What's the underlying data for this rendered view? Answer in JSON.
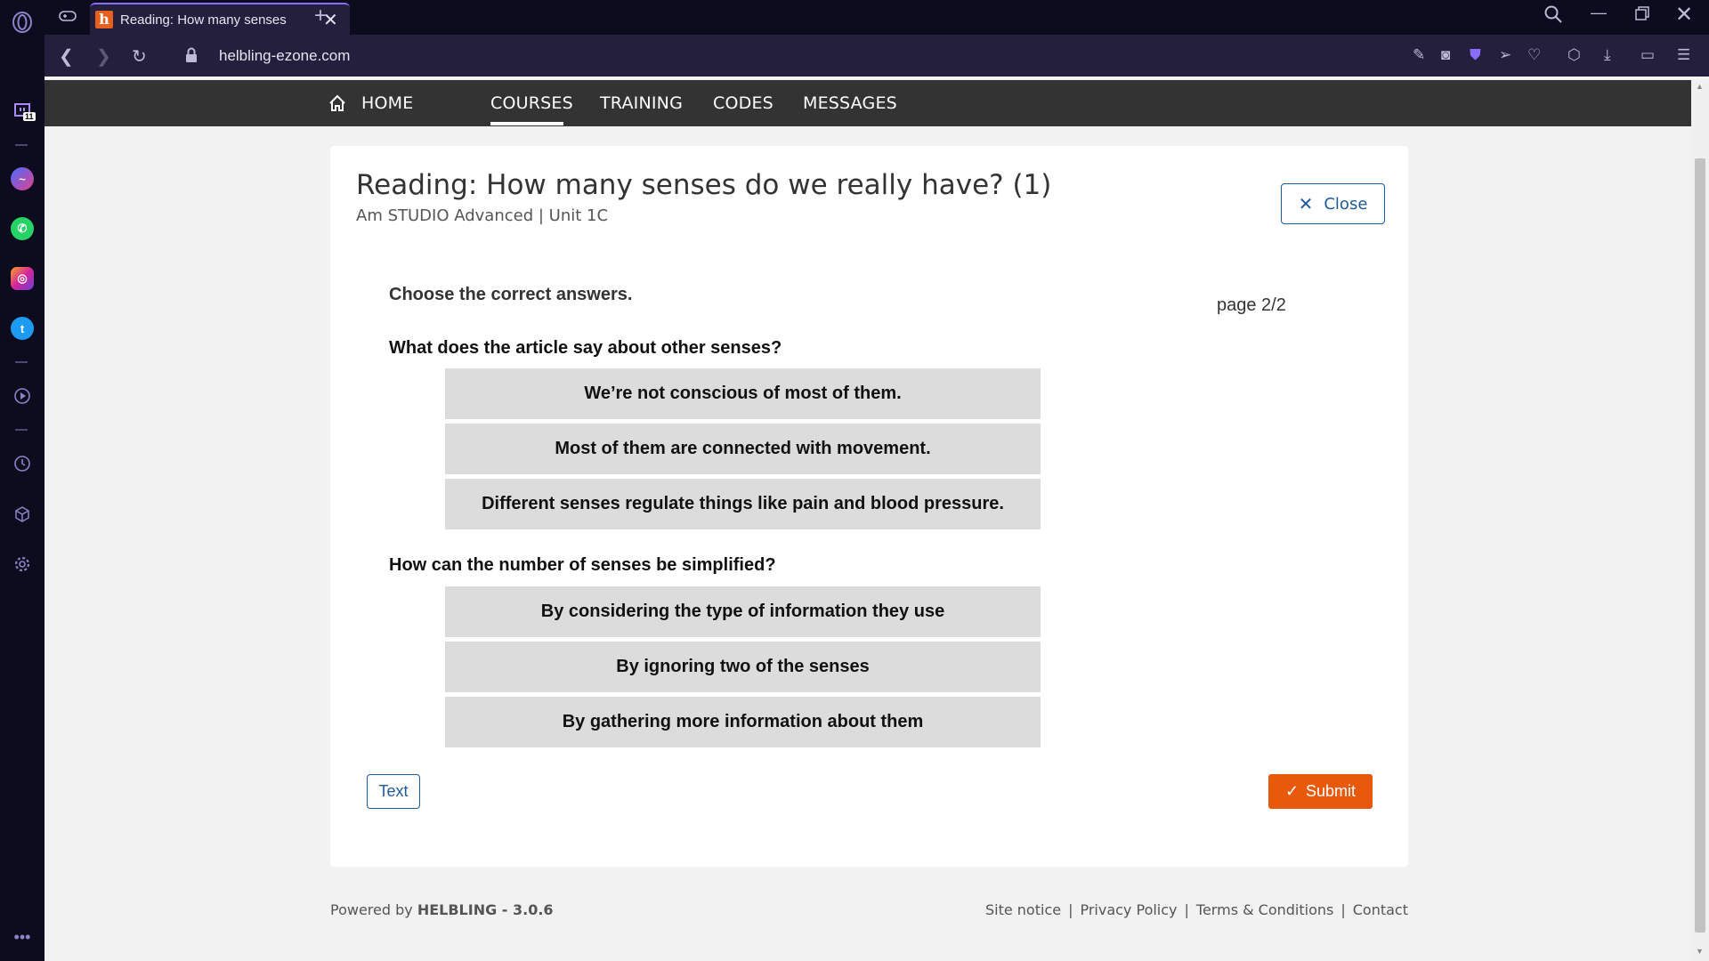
{
  "browser": {
    "tab_title": "Reading: How many senses",
    "favicon_letter": "h",
    "url": "helbling-ezone.com",
    "sidebar_badge": "11"
  },
  "site_nav": {
    "items": [
      "HOME",
      "COURSES",
      "TRAINING",
      "CODES",
      "MESSAGES"
    ],
    "active": "COURSES"
  },
  "activity": {
    "title": "Reading: How many senses do we really have? (1)",
    "subtitle": "Am STUDIO Advanced | Unit 1C",
    "close_label": "Close",
    "instruction": "Choose the correct answers.",
    "page_indicator": "page 2/2",
    "questions": [
      {
        "text": "What does the article say about other senses?",
        "options": [
          "We’re not conscious of most of them.",
          "Most of them are connected with movement.",
          "Different senses regulate things like pain and blood pressure."
        ]
      },
      {
        "text": "How can the number of senses be simplified?",
        "options": [
          "By considering the type of information they use",
          "By ignoring two of the senses",
          "By gathering more information about them"
        ]
      }
    ],
    "text_button": "Text",
    "submit_button": "Submit"
  },
  "footer": {
    "powered_prefix": "Powered by",
    "powered_brand": "HELBLING - 3.0.6",
    "links": [
      "Site notice",
      "Privacy Policy",
      "Terms & Conditions",
      "Contact"
    ]
  },
  "colors": {
    "accent_blue": "#1f5a9a",
    "submit_orange": "#e8590c",
    "header_dark": "#333333",
    "option_grey": "#dcdcdc"
  }
}
